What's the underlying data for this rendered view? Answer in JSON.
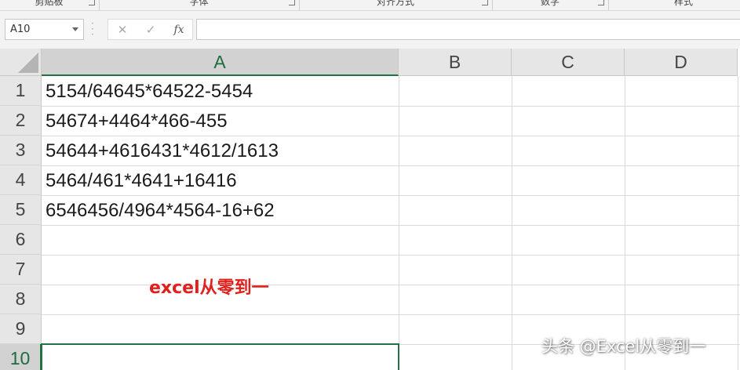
{
  "ribbon": {
    "groups": [
      "剪贴板",
      "字体",
      "对齐方式",
      "数字",
      "样式"
    ]
  },
  "formula_bar": {
    "name_box": "A10",
    "cancel_icon": "✕",
    "enter_icon": "✓",
    "function_icon": "fx",
    "formula": ""
  },
  "sheet": {
    "columns": [
      "A",
      "B",
      "C",
      "D"
    ],
    "selected_column": "A",
    "rows": [
      "1",
      "2",
      "3",
      "4",
      "5",
      "6",
      "7",
      "8",
      "9",
      "10"
    ],
    "selected_row": "10",
    "cells_a": [
      "5154/64645*64522-5454",
      "54674+4464*466-455",
      "54644+4616431*4612/1613",
      "5464/461*4641+16416",
      "6546456/4964*4564-16+62"
    ],
    "note": "excel从零到一",
    "note_color": "#e0201c"
  },
  "watermark": "头条 @Excel从零到一",
  "colors": {
    "accent": "#217346",
    "header_bg": "#e6e6e6"
  }
}
